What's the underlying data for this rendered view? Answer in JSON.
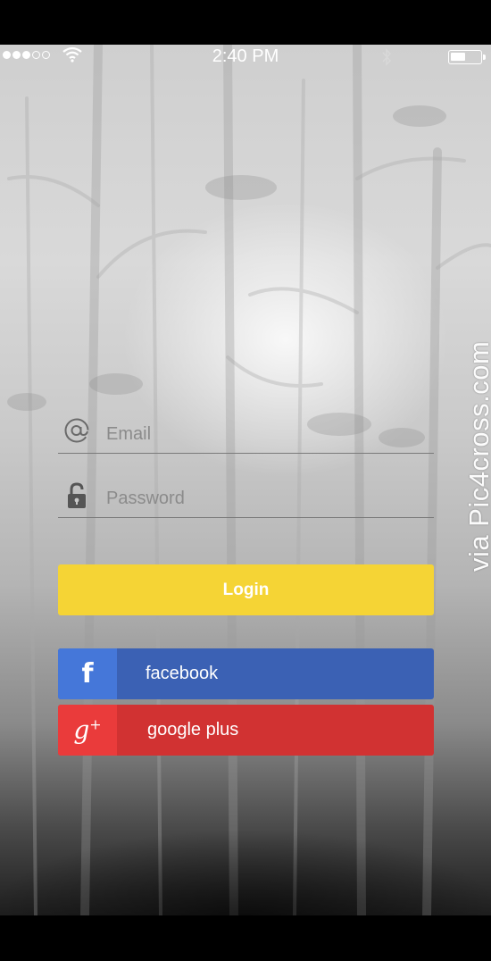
{
  "status_bar": {
    "signal_dots": [
      true,
      true,
      true,
      false,
      false
    ],
    "time": "2:40 PM",
    "battery_level": 0.5,
    "icons": [
      "wifi-icon",
      "bluetooth-icon",
      "battery-icon"
    ]
  },
  "login_form": {
    "email": {
      "placeholder": "Email",
      "value": "",
      "icon": "at-icon"
    },
    "password": {
      "placeholder": "Password",
      "value": "",
      "icon": "lock-icon"
    },
    "login_label": "Login"
  },
  "social": {
    "facebook": {
      "label": "facebook",
      "icon": "facebook-icon"
    },
    "google": {
      "label": "google plus",
      "icon": "google-plus-icon"
    }
  },
  "colors": {
    "login": "#f5d435",
    "facebook": "#3b61b4",
    "facebook_icon_bg": "#4577d9",
    "google": "#d13232",
    "google_icon_bg": "#ea3b3b"
  },
  "watermark": "via Pic4cross.com"
}
